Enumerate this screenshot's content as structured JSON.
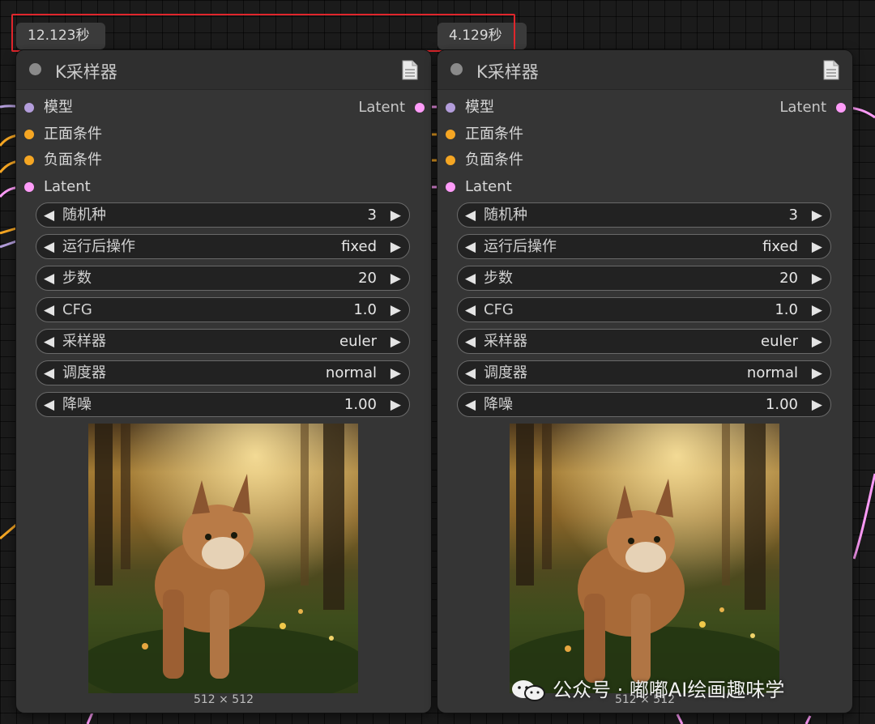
{
  "timings": [
    "12.123秒",
    "4.129秒"
  ],
  "nodes": [
    {
      "title": "K采样器",
      "inputs": [
        "模型",
        "正面条件",
        "负面条件",
        "Latent"
      ],
      "output": "Latent",
      "widgets": [
        {
          "label": "随机种",
          "value": "3"
        },
        {
          "label": "运行后操作",
          "value": "fixed"
        },
        {
          "label": "步数",
          "value": "20"
        },
        {
          "label": "CFG",
          "value": "1.0"
        },
        {
          "label": "采样器",
          "value": "euler"
        },
        {
          "label": "调度器",
          "value": "normal"
        },
        {
          "label": "降噪",
          "value": "1.00"
        }
      ],
      "image_size": "512 × 512"
    },
    {
      "title": "K采样器",
      "inputs": [
        "模型",
        "正面条件",
        "负面条件",
        "Latent"
      ],
      "output": "Latent",
      "widgets": [
        {
          "label": "随机种",
          "value": "3"
        },
        {
          "label": "运行后操作",
          "value": "fixed"
        },
        {
          "label": "步数",
          "value": "20"
        },
        {
          "label": "CFG",
          "value": "1.0"
        },
        {
          "label": "采样器",
          "value": "euler"
        },
        {
          "label": "调度器",
          "value": "normal"
        },
        {
          "label": "降噪",
          "value": "1.00"
        }
      ],
      "image_size": "512 × 512"
    }
  ],
  "watermark": "公众号 · 嘟嘟AI绘画趣味学",
  "colors": {
    "model": "#b39ddb",
    "conditioning": "#f5a623",
    "latent": "#ff9cf9",
    "highlight": "#e0262c"
  },
  "icons": {
    "arrow_left": "◀",
    "arrow_right": "▶",
    "node_doc": "document-icon",
    "watermark": "wechat-icon"
  }
}
